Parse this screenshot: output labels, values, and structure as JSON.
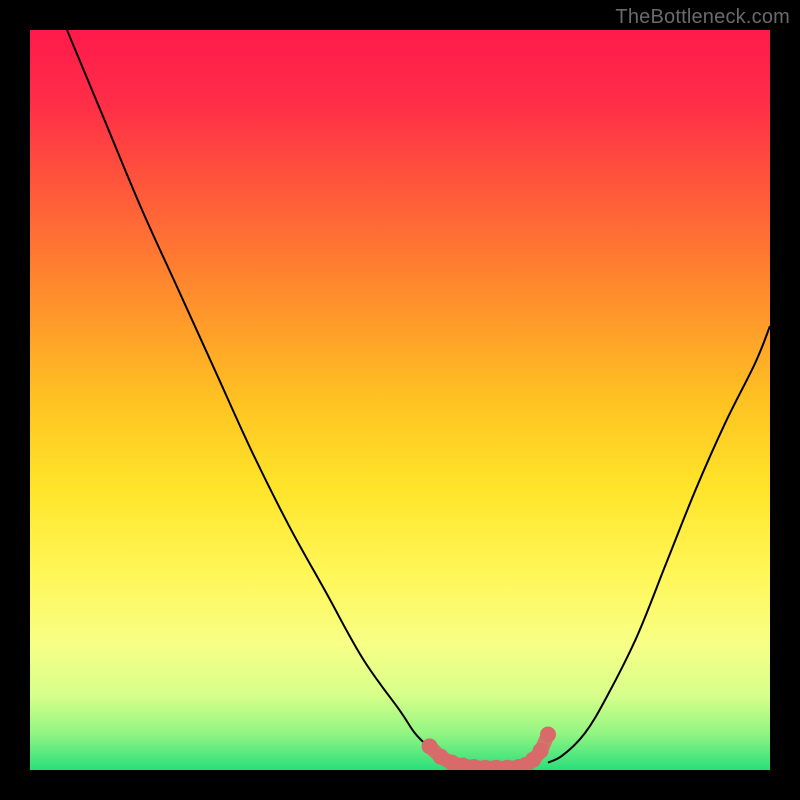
{
  "watermark": "TheBottleneck.com",
  "colors": {
    "frame": "#000000",
    "curve": "#000000",
    "marker_fill": "#d86a6a",
    "marker_stroke": "#b94e4e",
    "gradient_stops": [
      {
        "offset": 0.0,
        "color": "#ff1a4b"
      },
      {
        "offset": 0.1,
        "color": "#ff2e47"
      },
      {
        "offset": 0.22,
        "color": "#ff5a3a"
      },
      {
        "offset": 0.35,
        "color": "#ff8a2d"
      },
      {
        "offset": 0.5,
        "color": "#ffc222"
      },
      {
        "offset": 0.62,
        "color": "#ffe52a"
      },
      {
        "offset": 0.74,
        "color": "#fff75a"
      },
      {
        "offset": 0.83,
        "color": "#f7ff86"
      },
      {
        "offset": 0.9,
        "color": "#d6ff8a"
      },
      {
        "offset": 0.95,
        "color": "#93f582"
      },
      {
        "offset": 1.0,
        "color": "#29e07a"
      }
    ]
  },
  "chart_data": {
    "type": "line",
    "title": "",
    "xlabel": "",
    "ylabel": "",
    "xlim": [
      0,
      100
    ],
    "ylim": [
      0,
      100
    ],
    "grid": false,
    "series": [
      {
        "name": "left-curve",
        "x": [
          5,
          10,
          15,
          20,
          25,
          30,
          35,
          40,
          45,
          50,
          52,
          54,
          56,
          58
        ],
        "y": [
          100,
          88,
          76,
          65,
          54,
          43,
          33,
          24,
          15,
          8,
          5,
          3,
          1.5,
          0.8
        ]
      },
      {
        "name": "right-curve",
        "x": [
          70,
          72,
          75,
          78,
          82,
          86,
          90,
          94,
          98,
          100
        ],
        "y": [
          1,
          2,
          5,
          10,
          18,
          28,
          38,
          47,
          55,
          60
        ]
      },
      {
        "name": "bottom-markers",
        "x": [
          54,
          55.5,
          57,
          58.5,
          60,
          61.5,
          63,
          64.5,
          66,
          67,
          68,
          69,
          70
        ],
        "y": [
          3.2,
          1.8,
          1.0,
          0.6,
          0.4,
          0.3,
          0.3,
          0.3,
          0.4,
          0.7,
          1.4,
          2.6,
          4.8
        ]
      }
    ],
    "annotations": []
  }
}
